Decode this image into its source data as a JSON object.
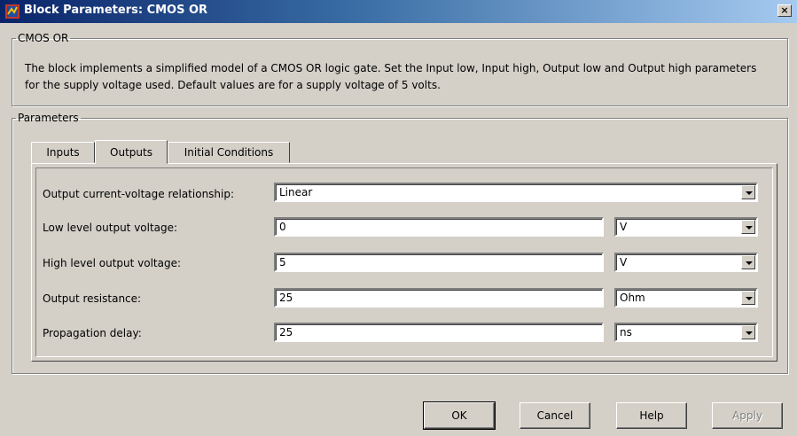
{
  "window": {
    "title": "Block Parameters: CMOS OR",
    "close_label": "×"
  },
  "description_group": {
    "legend": "CMOS OR",
    "text": "The block implements a simplified model of a CMOS OR logic gate. Set the Input low, Input high, Output low and Output high parameters for the supply voltage used. Default values are for a supply voltage of 5 volts."
  },
  "parameters_group": {
    "legend": "Parameters"
  },
  "tabs": [
    {
      "label": "Inputs",
      "active": false
    },
    {
      "label": "Outputs",
      "active": true
    },
    {
      "label": "Initial Conditions",
      "active": false
    }
  ],
  "rows": [
    {
      "label": "Output current-voltage relationship:",
      "value": "Linear",
      "type": "select"
    },
    {
      "label": "Low level output voltage:",
      "value": "0",
      "unit": "V"
    },
    {
      "label": "High level output voltage:",
      "value": "5",
      "unit": "V"
    },
    {
      "label": "Output resistance:",
      "value": "25",
      "unit": "Ohm"
    },
    {
      "label": "Propagation delay:",
      "value": "25",
      "unit": "ns"
    }
  ],
  "buttons": {
    "ok": "OK",
    "cancel": "Cancel",
    "help": "Help",
    "apply": "Apply"
  },
  "colors": {
    "titlebar_start": "#0a246a",
    "titlebar_end": "#a6caf0",
    "dialog_bg": "#d4d0c8"
  },
  "icons": {
    "title": "simulink-block-icon",
    "close": "close-icon",
    "dropdown": "chevron-down-icon"
  }
}
